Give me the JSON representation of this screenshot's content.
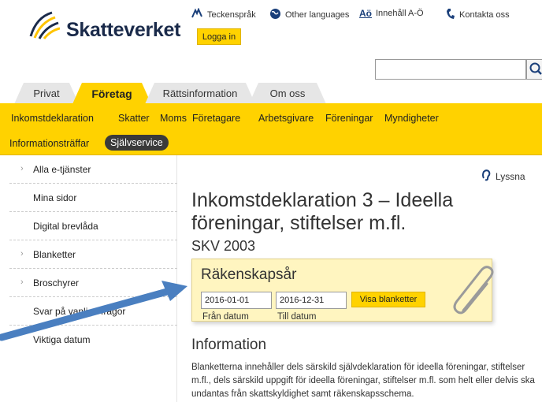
{
  "header": {
    "logo_text": "Skatteverket",
    "login_label": "Logga in",
    "util_links": [
      {
        "label": "Teckenspråk",
        "icon": "sign-language-icon"
      },
      {
        "label": "Other languages",
        "icon": "globe-icon"
      },
      {
        "label": "Innehåll A-Ö",
        "icon": "ao-index-icon",
        "icon_text": "Aö"
      },
      {
        "label": "Kontakta oss",
        "icon": "phone-icon"
      }
    ],
    "search": {
      "placeholder": "",
      "icon": "search-icon"
    }
  },
  "tabs": [
    {
      "label": "Privat",
      "active": false
    },
    {
      "label": "Företag",
      "active": true
    },
    {
      "label": "Rättsinformation",
      "active": false
    },
    {
      "label": "Om oss",
      "active": false
    }
  ],
  "nav": {
    "row1": [
      "Inkomstdeklaration",
      "Skatter",
      "Moms",
      "Företagare",
      "Arbetsgivare",
      "Föreningar",
      "Myndigheter"
    ],
    "row2": [
      "Informationsträffar"
    ],
    "active": "Självservice"
  },
  "sidebar": {
    "items": [
      {
        "label": "Alla e-tjänster",
        "chevron": true
      },
      {
        "label": "Mina sidor",
        "chevron": false
      },
      {
        "label": "Digital brevlåda",
        "chevron": false
      },
      {
        "label": "Blanketter",
        "chevron": true
      },
      {
        "label": "Broschyrer",
        "chevron": true
      },
      {
        "label": "Svar på vanliga frågor",
        "chevron": false
      },
      {
        "label": "Viktiga datum",
        "chevron": false
      }
    ]
  },
  "main": {
    "listen_label": "Lyssna",
    "title": "Inkomstdeklaration 3 – Ideella föreningar, stiftelser m.fl.",
    "form_code": "SKV 2003",
    "form_box": {
      "label": "Räkenskapsår",
      "from_value": "2016-01-01",
      "to_value": "2016-12-31",
      "from_hint": "Från datum",
      "to_hint": "Till datum",
      "submit_label": "Visa blanketter"
    },
    "info_heading": "Information",
    "info_text": "Blanketterna innehåller dels särskild självdeklaration för ideella föreningar, stiftelser m.fl., dels särskild uppgift för ideella föreningar, stiftelser m.fl. som helt eller delvis ska undantas från skattskyldighet samt räkenskapsschema."
  },
  "colors": {
    "brand_yellow": "#ffd200",
    "form_box_bg": "#fff5c0",
    "arrow": "#4a7fc0",
    "active_pill": "#3a3a3a"
  }
}
